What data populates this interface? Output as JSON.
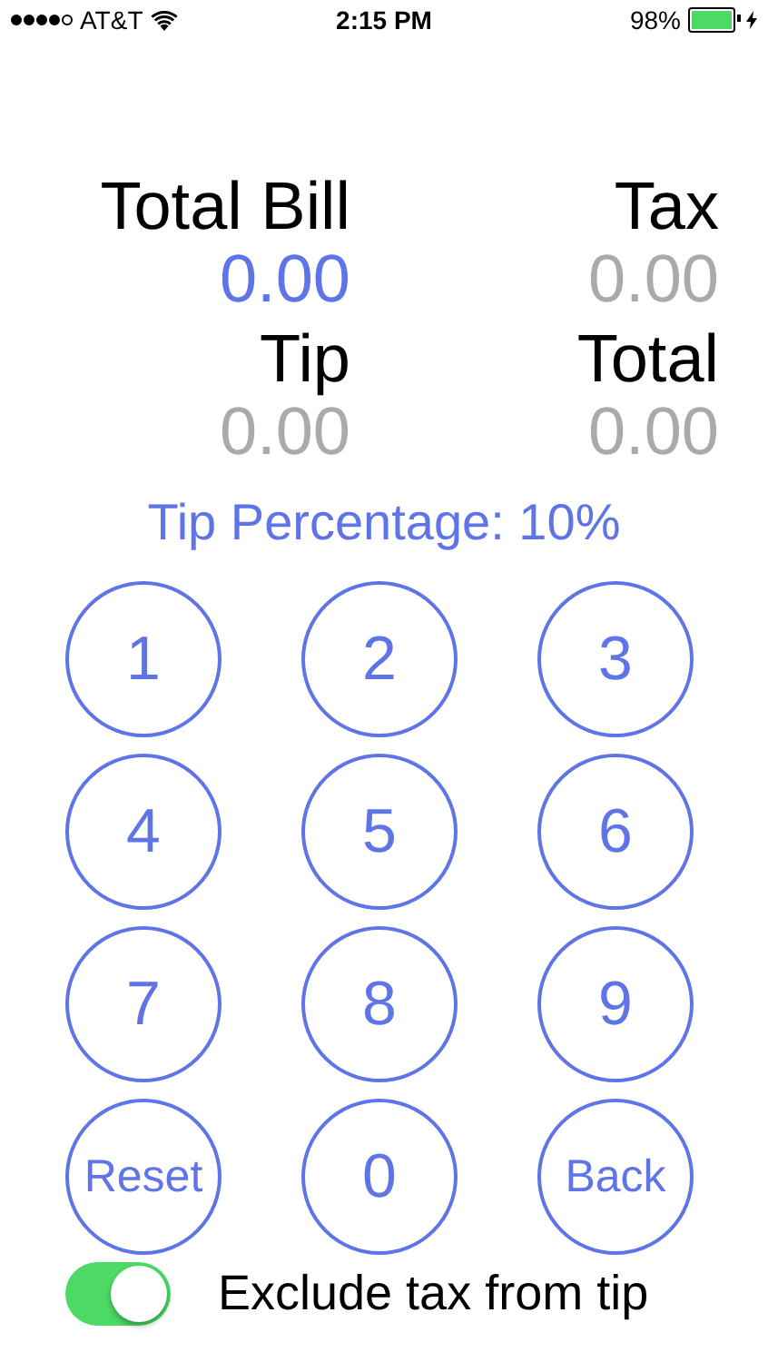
{
  "status_bar": {
    "carrier": "AT&T",
    "time": "2:15 PM",
    "battery_percent": "98%",
    "charging": true
  },
  "fields": [
    {
      "label": "Total Bill",
      "value": "0.00",
      "selected": true
    },
    {
      "label": "Tax",
      "value": "0.00",
      "selected": false
    },
    {
      "label": "Tip",
      "value": "0.00",
      "selected": false
    },
    {
      "label": "Total",
      "value": "0.00",
      "selected": false
    }
  ],
  "tip_percentage": "Tip Percentage: 10%",
  "keys": [
    {
      "label": "1",
      "kind": "digit"
    },
    {
      "label": "2",
      "kind": "digit"
    },
    {
      "label": "3",
      "kind": "digit"
    },
    {
      "label": "4",
      "kind": "digit"
    },
    {
      "label": "5",
      "kind": "digit"
    },
    {
      "label": "6",
      "kind": "digit"
    },
    {
      "label": "7",
      "kind": "digit"
    },
    {
      "label": "8",
      "kind": "digit"
    },
    {
      "label": "9",
      "kind": "digit"
    },
    {
      "label": "Reset",
      "kind": "word"
    },
    {
      "label": "0",
      "kind": "digit"
    },
    {
      "label": "Back",
      "kind": "word"
    }
  ],
  "exclude_tax": {
    "label": "Exclude tax from tip",
    "on": true
  }
}
